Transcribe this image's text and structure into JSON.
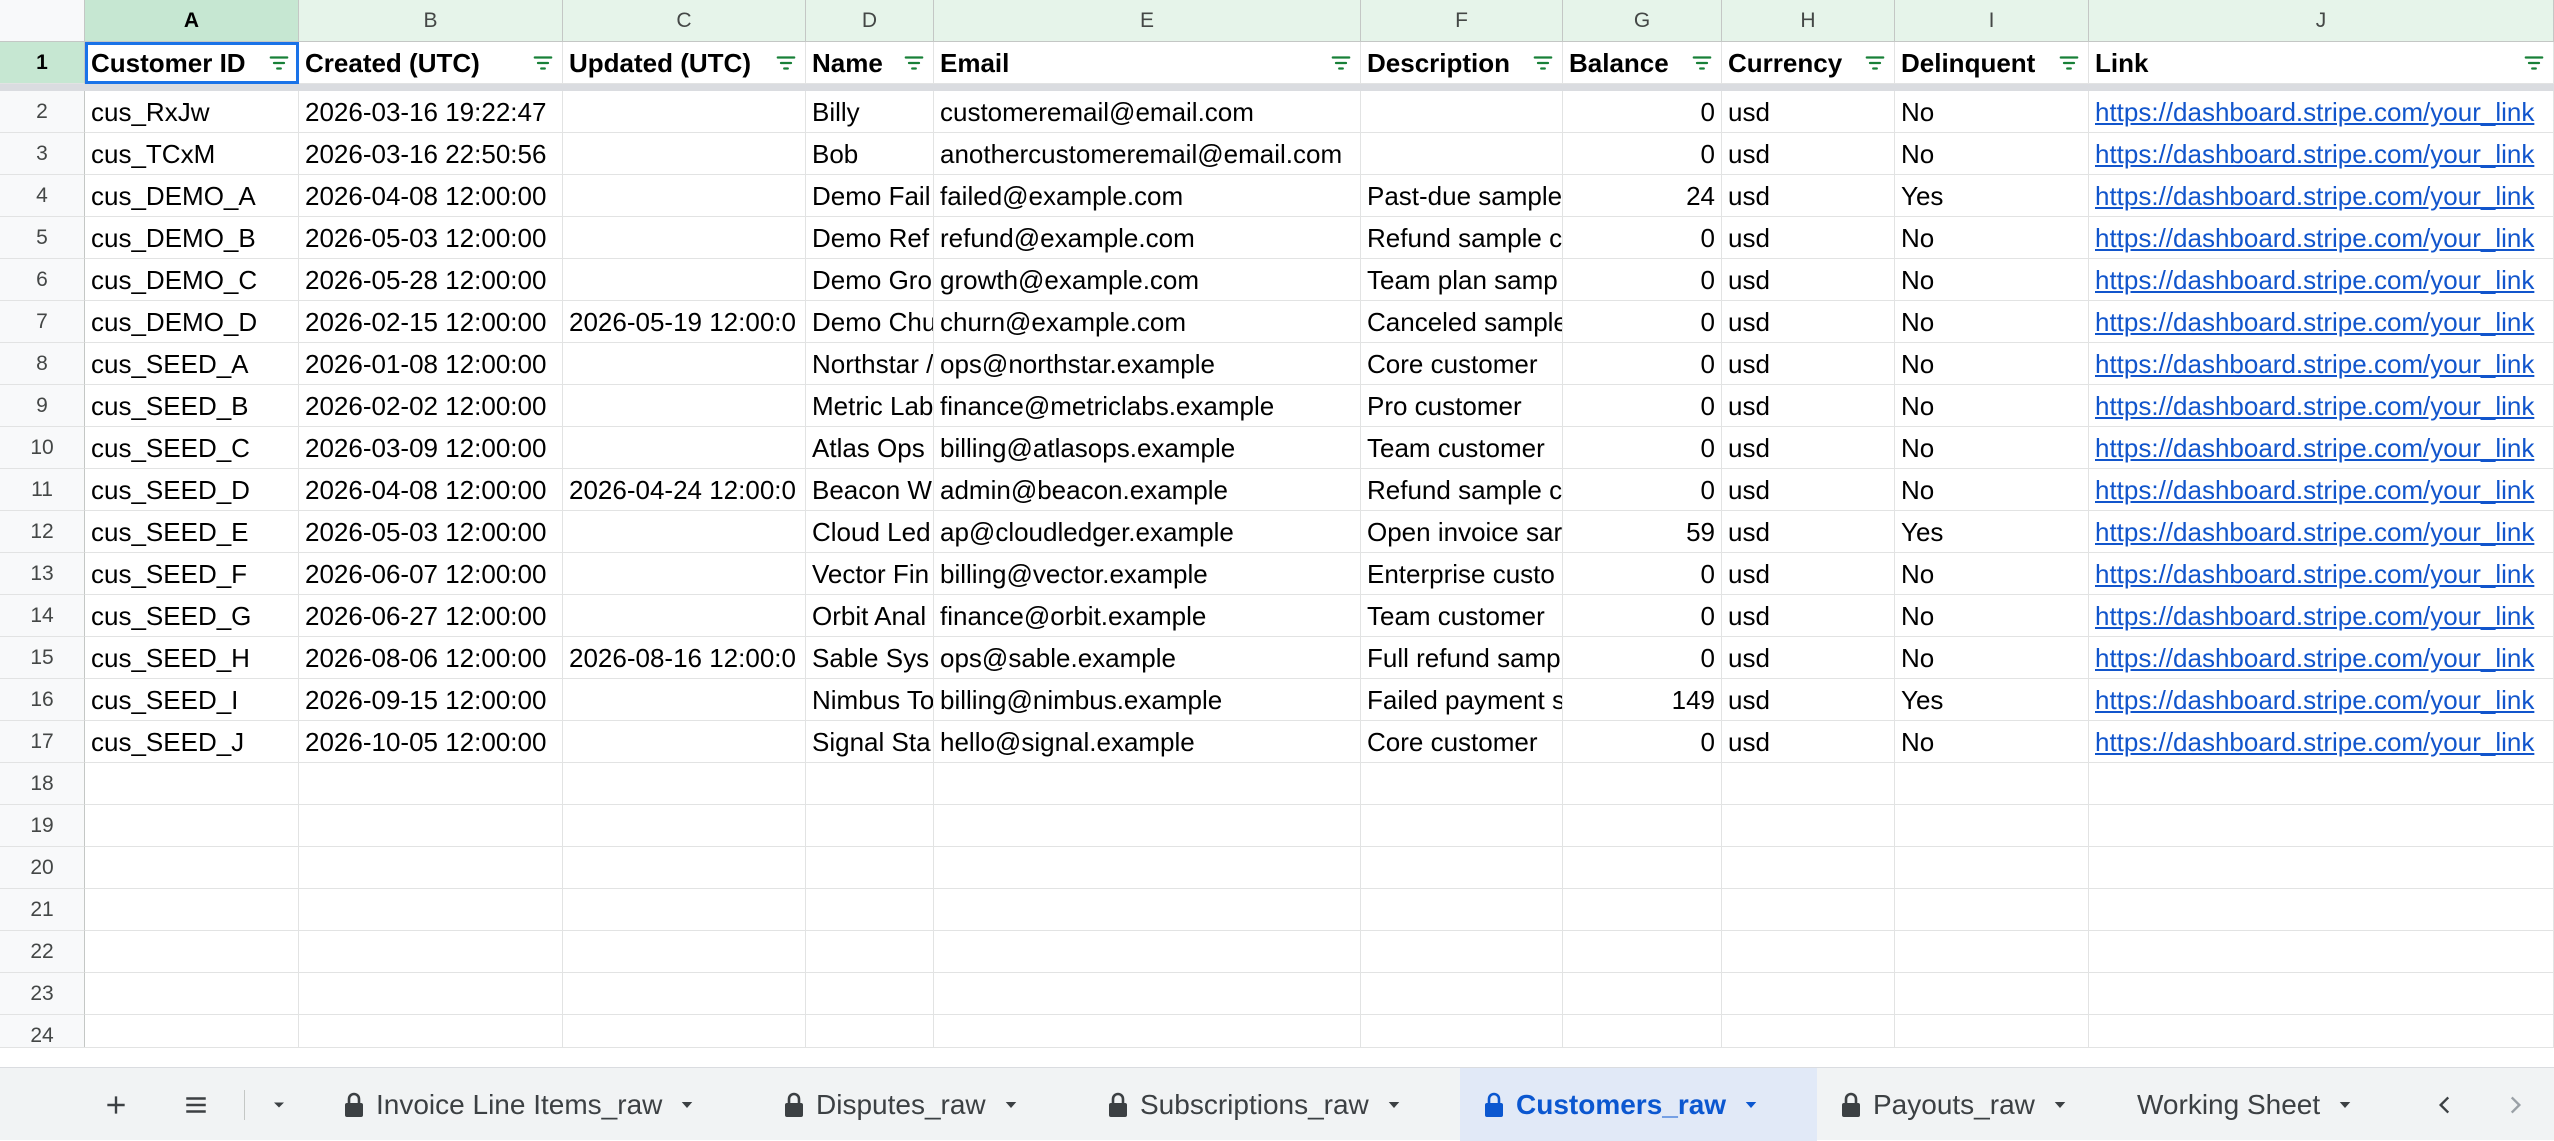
{
  "columns": [
    "A",
    "B",
    "C",
    "D",
    "E",
    "F",
    "G",
    "H",
    "I",
    "J"
  ],
  "headers": [
    "Customer ID",
    "Created (UTC)",
    "Updated (UTC)",
    "Name",
    "Email",
    "Description",
    "Balance",
    "Currency",
    "Delinquent",
    "Link"
  ],
  "rows": [
    [
      "cus_RxJw",
      "2026-03-16 19:22:47",
      "",
      "Billy",
      "customeremail@email.com",
      "",
      "0",
      "usd",
      "No",
      "https://dashboard.stripe.com/your_link"
    ],
    [
      "cus_TCxM",
      "2026-03-16 22:50:56",
      "",
      "Bob",
      "anothercustomeremail@email.com",
      "",
      "0",
      "usd",
      "No",
      "https://dashboard.stripe.com/your_link"
    ],
    [
      "cus_DEMO_A",
      "2026-04-08 12:00:00",
      "",
      "Demo Fail",
      "failed@example.com",
      "Past-due sample",
      "24",
      "usd",
      "Yes",
      "https://dashboard.stripe.com/your_link"
    ],
    [
      "cus_DEMO_B",
      "2026-05-03 12:00:00",
      "",
      "Demo Ref",
      "refund@example.com",
      "Refund sample c",
      "0",
      "usd",
      "No",
      "https://dashboard.stripe.com/your_link"
    ],
    [
      "cus_DEMO_C",
      "2026-05-28 12:00:00",
      "",
      "Demo Gro",
      "growth@example.com",
      "Team plan samp",
      "0",
      "usd",
      "No",
      "https://dashboard.stripe.com/your_link"
    ],
    [
      "cus_DEMO_D",
      "2026-02-15 12:00:00",
      "2026-05-19 12:00:0",
      "Demo Chu",
      "churn@example.com",
      "Canceled sample",
      "0",
      "usd",
      "No",
      "https://dashboard.stripe.com/your_link"
    ],
    [
      "cus_SEED_A",
      "2026-01-08 12:00:00",
      "",
      "Northstar /",
      "ops@northstar.example",
      "Core customer",
      "0",
      "usd",
      "No",
      "https://dashboard.stripe.com/your_link"
    ],
    [
      "cus_SEED_B",
      "2026-02-02 12:00:00",
      "",
      "Metric Lab",
      "finance@metriclabs.example",
      "Pro customer",
      "0",
      "usd",
      "No",
      "https://dashboard.stripe.com/your_link"
    ],
    [
      "cus_SEED_C",
      "2026-03-09 12:00:00",
      "",
      "Atlas Ops",
      "billing@atlasops.example",
      "Team customer",
      "0",
      "usd",
      "No",
      "https://dashboard.stripe.com/your_link"
    ],
    [
      "cus_SEED_D",
      "2026-04-08 12:00:00",
      "2026-04-24 12:00:0",
      "Beacon W",
      "admin@beacon.example",
      "Refund sample c",
      "0",
      "usd",
      "No",
      "https://dashboard.stripe.com/your_link"
    ],
    [
      "cus_SEED_E",
      "2026-05-03 12:00:00",
      "",
      "Cloud Led",
      "ap@cloudledger.example",
      "Open invoice sar",
      "59",
      "usd",
      "Yes",
      "https://dashboard.stripe.com/your_link"
    ],
    [
      "cus_SEED_F",
      "2026-06-07 12:00:00",
      "",
      "Vector Fin",
      "billing@vector.example",
      "Enterprise custo",
      "0",
      "usd",
      "No",
      "https://dashboard.stripe.com/your_link"
    ],
    [
      "cus_SEED_G",
      "2026-06-27 12:00:00",
      "",
      "Orbit Anal",
      "finance@orbit.example",
      "Team customer",
      "0",
      "usd",
      "No",
      "https://dashboard.stripe.com/your_link"
    ],
    [
      "cus_SEED_H",
      "2026-08-06 12:00:00",
      "2026-08-16 12:00:0",
      "Sable Sys",
      "ops@sable.example",
      "Full refund samp",
      "0",
      "usd",
      "No",
      "https://dashboard.stripe.com/your_link"
    ],
    [
      "cus_SEED_I",
      "2026-09-15 12:00:00",
      "",
      "Nimbus To",
      "billing@nimbus.example",
      "Failed payment s",
      "149",
      "usd",
      "Yes",
      "https://dashboard.stripe.com/your_link"
    ],
    [
      "cus_SEED_J",
      "2026-10-05 12:00:00",
      "",
      "Signal Sta",
      "hello@signal.example",
      "Core customer",
      "0",
      "usd",
      "No",
      "https://dashboard.stripe.com/your_link"
    ]
  ],
  "row_numbers": [
    "1",
    "2",
    "3",
    "4",
    "5",
    "6",
    "7",
    "8",
    "9",
    "10",
    "11",
    "12",
    "13",
    "14",
    "15",
    "16",
    "17",
    "18",
    "19",
    "20",
    "21",
    "22",
    "23",
    "24"
  ],
  "selected_cell": "A1",
  "sheet_tabs": [
    {
      "label": "Invoice Line Items_raw",
      "locked": true,
      "active": false
    },
    {
      "label": "Disputes_raw",
      "locked": true,
      "active": false
    },
    {
      "label": "Subscriptions_raw",
      "locked": true,
      "active": false
    },
    {
      "label": "Customers_raw",
      "locked": true,
      "active": true
    },
    {
      "label": "Payouts_raw",
      "locked": true,
      "active": false
    },
    {
      "label": "Working Sheet",
      "locked": false,
      "active": false
    }
  ],
  "icons": {
    "add_sheet": "plus-icon",
    "all_sheets": "menu-icon",
    "sheet_menu": "chevron-down-icon",
    "filter": "filter-icon",
    "lock": "lock-icon",
    "scroll_left": "chevron-left-icon",
    "scroll_right": "chevron-right-icon"
  },
  "colors": {
    "accent": "#1a73e8",
    "active_tab_text": "#0b57d0",
    "active_tab_bg": "#e1e9f7",
    "link": "#1155cc",
    "filter_icon": "#188038",
    "header_filtered_bg": "#e6f4ea"
  }
}
